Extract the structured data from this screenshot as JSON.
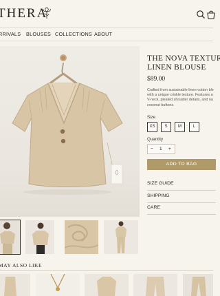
{
  "brand": "THERA",
  "nav": [
    "RRIVALS",
    "BLOUSES",
    "COLLECTIONS",
    "ABOUT"
  ],
  "product": {
    "title": "THE NOVA TEXTUR\nLINEN BLOUSE",
    "price": "$89.00",
    "description": [
      "Crafted from sustainable linen-cotton ble",
      "with a unique crinkle texture. Features a",
      "V-neck, pleated shoulder details, and na",
      "coconut buttons."
    ]
  },
  "size": {
    "label": "Size",
    "options": [
      "XS",
      "S",
      "M",
      "L"
    ]
  },
  "quantity": {
    "label": "Quantity",
    "minus": "−",
    "value": "1",
    "plus": "+"
  },
  "add_to_bag": "ADD TO BAG",
  "accordions": [
    "SIZE GUIDE",
    "SHIPPING",
    "CARE"
  ],
  "also_like": "MAY ALSO LIKE",
  "colors": {
    "accent": "#b09a6a",
    "background": "#f7f4ee",
    "text": "#2b2622",
    "blouse": "#d8c5a6"
  },
  "icons": [
    "logo-flower-icon",
    "search-icon",
    "bag-icon"
  ]
}
